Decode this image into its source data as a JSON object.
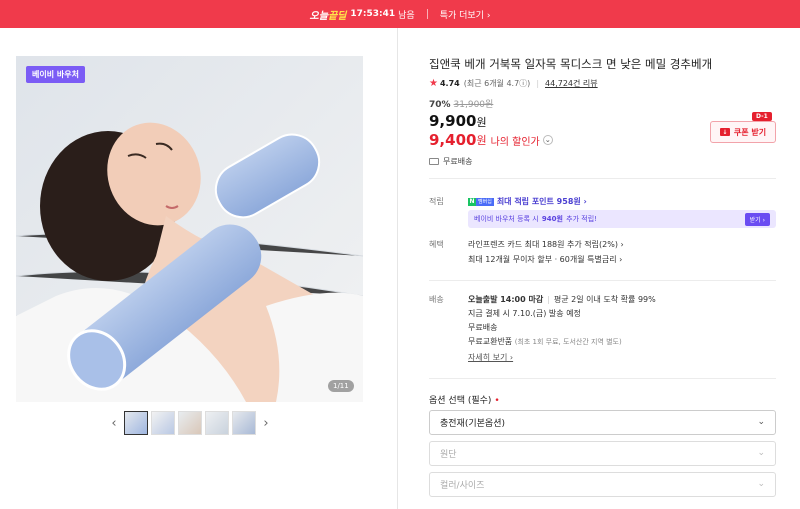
{
  "topbar": {
    "brand_a": "오늘",
    "brand_b": "끝딜",
    "time": "17:53:41",
    "time_suffix": "남음",
    "more_label": "특가 더보기 ›"
  },
  "gallery": {
    "voucher_badge": "베이비 바우처",
    "counter": "1/11",
    "thumb_count": 5
  },
  "product": {
    "title": "집앤쿡 베개 거북목 일자목 목디스크 면 낮은 메밀 경추베개",
    "rating": "4.74",
    "rating_recent": "(최근 6개월 4.7ⓘ)",
    "reviews": "44,724건 리뷰",
    "discount_pct": "70%",
    "original_price": "31,900원",
    "price": "9,900",
    "price_unit": "원",
    "my_price": "9,400",
    "my_price_unit": "원",
    "my_price_label": "나의 할인가",
    "coupon_label": "쿠폰 받기",
    "coupon_dday": "D-1",
    "free_shipping": "무료배송"
  },
  "points": {
    "label": "적립",
    "npay_n": "N",
    "npay_m": "멤버십",
    "text": "최대 적립 포인트 958원 ›",
    "voucher_text_a": "베이비 바우처 등록 시",
    "voucher_text_b": "940원",
    "voucher_text_c": "추가 적립!",
    "voucher_btn": "받기 ›"
  },
  "benefits": {
    "label": "혜택",
    "line1": "라인프렌즈 카드 최대 188원 추가 적립(2%) ›",
    "line2": "최대 12개월 무이자 할부 · 60개월 특별금리 ›"
  },
  "delivery": {
    "label": "배송",
    "line1a": "오늘출발 14:00 마감",
    "line1b": "평균 2일 이내 도착 확률 99%",
    "line2": "지금 결제 시 7.10.(금) 발송 예정",
    "line3": "무료배송",
    "line4a": "무료교환반품",
    "line4b": "(최초 1회 무료, 도서산간 지역 별도)",
    "more": "자세히 보기 ›"
  },
  "options": {
    "title": "옵션 선택 (필수)",
    "required_mark": "•",
    "select1": "충전재(기본옵션)",
    "select2": "원단",
    "select3": "컬러/사이즈"
  },
  "colors": {
    "accent_red": "#f03a4b",
    "price_red": "#e5202e",
    "voucher_purple": "#7b5cf5"
  }
}
